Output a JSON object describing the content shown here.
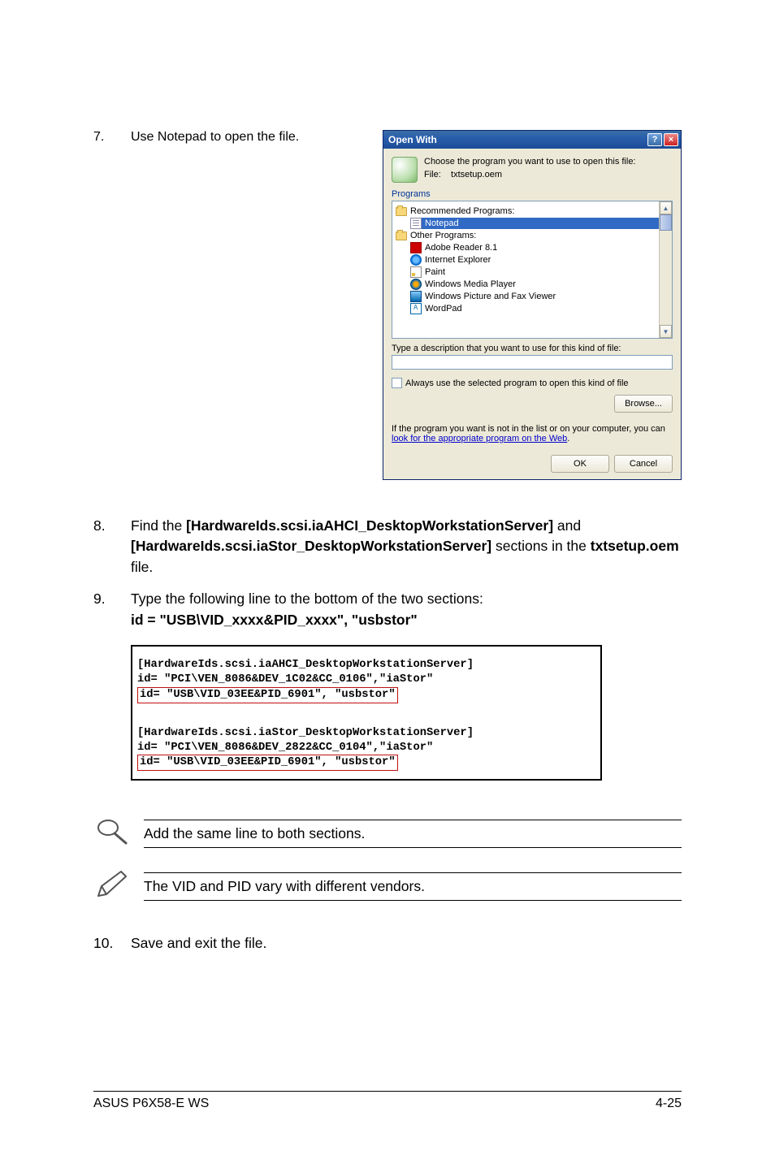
{
  "step7": {
    "num": "7.",
    "text": "Use Notepad to open the file."
  },
  "dialog": {
    "title": "Open With",
    "choose": "Choose the program you want to use to open this file:",
    "file_label": "File:",
    "file_name": "txtsetup.oem",
    "programs_label": "Programs",
    "group_recommended": "Recommended Programs:",
    "item_notepad": "Notepad",
    "group_other": "Other Programs:",
    "item_adobe": "Adobe Reader 8.1",
    "item_ie": "Internet Explorer",
    "item_paint": "Paint",
    "item_wmp": "Windows Media Player",
    "item_pic": "Windows Picture and Fax Viewer",
    "item_wordpad": "WordPad",
    "desc_label": "Type a description that you want to use for this kind of file:",
    "checkbox_label": "Always use the selected program to open this kind of file",
    "browse_btn": "Browse...",
    "not_in_list": "If the program you want is not in the list or on your computer, you can ",
    "link_text": "look for the appropriate program on the Web",
    "ok_btn": "OK",
    "cancel_btn": "Cancel"
  },
  "step8": {
    "num": "8.",
    "pre": "Find the ",
    "sect1": "[HardwareIds.scsi.iaAHCI_DesktopWorkstationServer]",
    "mid": " and ",
    "sect2": "[HardwareIds.scsi.iaStor_DesktopWorkstationServer]",
    "post1": " sections in the ",
    "file": "txtsetup.oem",
    "post2": " file."
  },
  "step9": {
    "num": "9.",
    "line1": "Type the following line to the bottom of the two sections:",
    "line2": "id = \"USB\\VID_xxxx&PID_xxxx\", \"usbstor\""
  },
  "code": {
    "a1": "[HardwareIds.scsi.iaAHCI_DesktopWorkstationServer]",
    "a2": "id= \"PCI\\VEN_8086&DEV_1C02&CC_0106\",\"iaStor\"",
    "a3": "id= \"USB\\VID_03EE&PID_6901\", \"usbstor\"",
    "b1": "[HardwareIds.scsi.iaStor_DesktopWorkstationServer]",
    "b2": "id= \"PCI\\VEN_8086&DEV_2822&CC_0104\",\"iaStor\"",
    "b3": "id= \"USB\\VID_03EE&PID_6901\", \"usbstor\""
  },
  "note1": "Add the same line to both sections.",
  "note2": "The VID and PID vary with different vendors.",
  "step10": {
    "num": "10.",
    "text": "Save and exit the file."
  },
  "footer": {
    "left": "ASUS P6X58-E WS",
    "right": "4-25"
  }
}
